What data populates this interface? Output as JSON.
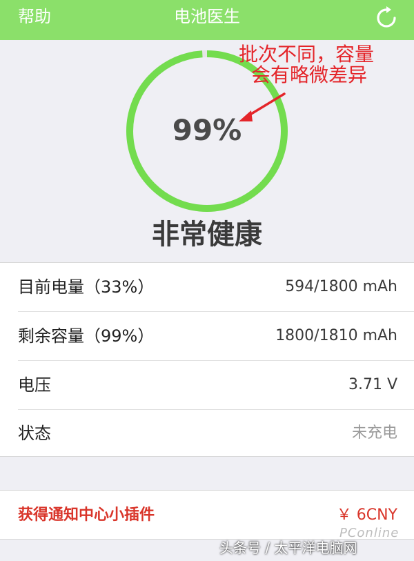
{
  "nav": {
    "left_label": "帮助",
    "title": "电池医生",
    "refresh_icon": "refresh-icon"
  },
  "hero": {
    "ring_fill": 0.99,
    "percent_text": "99%",
    "health_text": "非常健康",
    "ring_color": "#73dc4e",
    "annotation_line1": "批次不同，容量",
    "annotation_line2": "会有略微差异",
    "annotation_color": "#e4252a"
  },
  "battery_rows": [
    {
      "label": "目前电量（33%）",
      "value": "594/1800 mAh"
    },
    {
      "label": "剩余容量（99%）",
      "value": "1800/1810 mAh"
    },
    {
      "label": "电压",
      "value": "3.71 V"
    },
    {
      "label": "状态",
      "value": "未充电"
    }
  ],
  "widget": {
    "label": "获得通知中心小插件",
    "price": "￥ 6CNY"
  },
  "watermark": {
    "site": "PConline",
    "caption": "头条号 / 太平洋电脑网"
  }
}
